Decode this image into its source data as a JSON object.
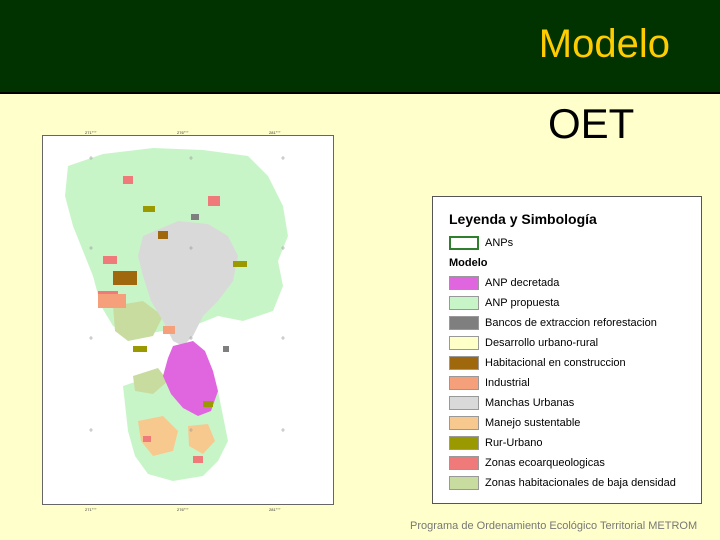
{
  "header": {
    "title": "Modelo",
    "subtitle": "OET"
  },
  "map": {
    "top_ticks": [
      "271°°°",
      "276°°°",
      "281°°°"
    ],
    "bottom_ticks": [
      "271°°°",
      "276°°°",
      "281°°°"
    ],
    "colors": {
      "urban": "#d9d9d9",
      "anp_decretada": "#e066e0",
      "anp_propuesta": "#c8f5c8",
      "bancos": "#7f7f7f",
      "desarrollo": "#ffffc8",
      "habitacional": "#a0680c",
      "industrial": "#f5a07a",
      "manejo": "#f7c98f",
      "rur_urbano": "#9a9a00",
      "ecoarq": "#f07a7a",
      "baja_densidad": "#c8dca0"
    }
  },
  "legend": {
    "title": "Leyenda y Simbología",
    "anps_label": "ANPs",
    "anps_color": "#2f7f2f",
    "section": "Modelo",
    "items": [
      {
        "label": "ANP decretada",
        "color": "#e066e0"
      },
      {
        "label": "ANP propuesta",
        "color": "#c8f5c8"
      },
      {
        "label": "Bancos de extraccion reforestacion",
        "color": "#7f7f7f"
      },
      {
        "label": "Desarrollo urbano-rural",
        "color": "#ffffc8"
      },
      {
        "label": "Habitacional en construccion",
        "color": "#a0680c"
      },
      {
        "label": "Industrial",
        "color": "#f5a07a"
      },
      {
        "label": "Manchas Urbanas",
        "color": "#d9d9d9"
      },
      {
        "label": "Manejo sustentable",
        "color": "#f7c98f"
      },
      {
        "label": "Rur-Urbano",
        "color": "#9a9a00"
      },
      {
        "label": "Zonas ecoarqueologicas",
        "color": "#f07a7a"
      },
      {
        "label": "Zonas habitacionales de baja densidad",
        "color": "#c8dca0"
      }
    ]
  },
  "footer": {
    "text": "Programa de Ordenamiento Ecológico Territorial METROM"
  }
}
